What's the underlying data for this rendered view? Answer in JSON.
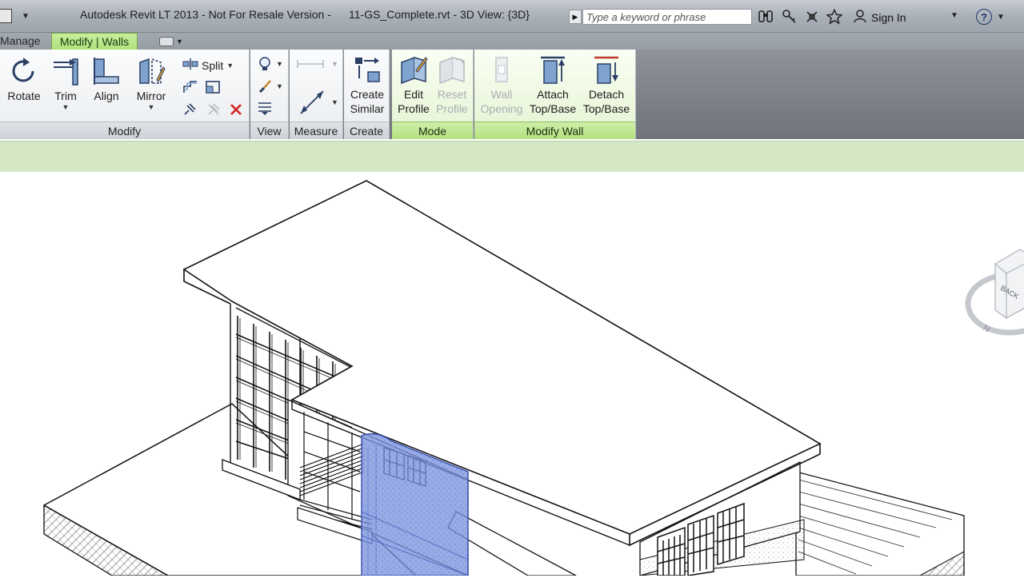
{
  "titlebar": {
    "app_title": "Autodesk Revit LT 2013 - Not For Resale Version -",
    "file_title": "11-GS_Complete.rvt - 3D View: {3D}",
    "search_placeholder": "Type a keyword or phrase",
    "sign_in_label": "Sign In",
    "help_glyph": "?"
  },
  "tabs": {
    "manage_label": "Manage",
    "active_label": "Modify | Walls"
  },
  "ribbon": {
    "modify": {
      "panel_label": "Modify",
      "rotate": "Rotate",
      "trim": "Trim",
      "align": "Align",
      "mirror": "Mirror",
      "split": "Split"
    },
    "view": {
      "panel_label": "View"
    },
    "measure": {
      "panel_label": "Measure"
    },
    "create": {
      "panel_label": "Create",
      "create_similar_line1": "Create",
      "create_similar_line2": "Similar"
    },
    "mode": {
      "panel_label": "Mode",
      "edit_profile_line1": "Edit",
      "edit_profile_line2": "Profile",
      "reset_profile_line1": "Reset",
      "reset_profile_line2": "Profile"
    },
    "modify_wall": {
      "panel_label": "Modify Wall",
      "wall_opening_line1": "Wall",
      "wall_opening_line2": "Opening",
      "attach_line1": "Attach",
      "attach_line2": "Top/Base",
      "detach_line1": "Detach",
      "detach_line2": "Top/Base"
    }
  },
  "viewcube": {
    "face_label": "BACK"
  },
  "colors": {
    "ribbon_context_green": "#b5e07f",
    "selected_wall_blue": "#7b93e0",
    "delete_red": "#d42020"
  }
}
